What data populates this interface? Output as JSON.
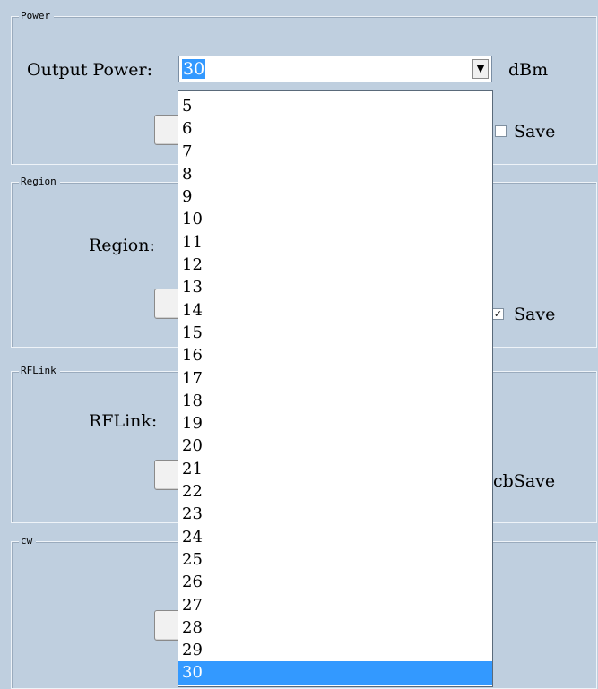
{
  "power": {
    "title": "Power",
    "output_power_label": "Output Power:",
    "selected_value": "30",
    "unit_label": "dBm",
    "save_label": "Save",
    "save_checked": false
  },
  "region": {
    "title": "Region",
    "region_label": "Region:",
    "save_label": "Save",
    "save_checked": true
  },
  "rflink": {
    "title": "RFLink",
    "rflink_label": "RFLink:",
    "save_label": "cbSave"
  },
  "cw": {
    "title": "cw"
  },
  "dropdown": {
    "options": [
      "5",
      "6",
      "7",
      "8",
      "9",
      "10",
      "11",
      "12",
      "13",
      "14",
      "15",
      "16",
      "17",
      "18",
      "19",
      "20",
      "21",
      "22",
      "23",
      "24",
      "25",
      "26",
      "27",
      "28",
      "29",
      "30"
    ],
    "selected_index": 25
  },
  "icons": {
    "combo_arrow": "chevron-down-icon",
    "checkmark": "checkmark-icon"
  },
  "colors": {
    "background": "#bfcfdf",
    "selection": "#3399ff"
  }
}
